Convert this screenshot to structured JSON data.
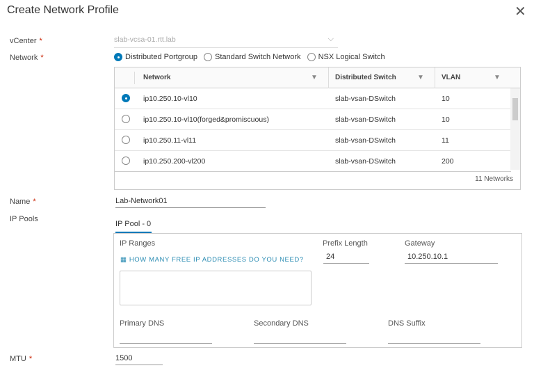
{
  "dialog": {
    "title": "Create Network Profile"
  },
  "vcenter": {
    "label": "vCenter",
    "required": "*",
    "value": "slab-vcsa-01.rtt.lab"
  },
  "network": {
    "label": "Network",
    "required": "*",
    "options": [
      "Distributed Portgroup",
      "Standard Switch Network",
      "NSX Logical Switch"
    ],
    "selected": 0,
    "columns": [
      "Network",
      "Distributed Switch",
      "VLAN"
    ],
    "rows": [
      {
        "network": "ip10.250.10-vl10",
        "switch": "slab-vsan-DSwitch",
        "vlan": "10",
        "selected": true
      },
      {
        "network": "ip10.250.10-vl10(forged&promiscuous)",
        "switch": "slab-vsan-DSwitch",
        "vlan": "10",
        "selected": false
      },
      {
        "network": "ip10.250.11-vl11",
        "switch": "slab-vsan-DSwitch",
        "vlan": "11",
        "selected": false
      },
      {
        "network": "ip10.250.200-vl200",
        "switch": "slab-vsan-DSwitch",
        "vlan": "200",
        "selected": false
      }
    ],
    "count": "11 Networks"
  },
  "name": {
    "label": "Name",
    "required": "*",
    "value": "Lab-Network01"
  },
  "ip_pools": {
    "label": "IP Pools",
    "tab": "IP Pool - 0",
    "ip_ranges": "IP Ranges",
    "link": "HOW MANY FREE IP ADDRESSES DO YOU NEED?",
    "prefix_label": "Prefix Length",
    "prefix": "24",
    "gateway_label": "Gateway",
    "gateway": "10.250.10.1",
    "primary_dns": "Primary DNS",
    "secondary_dns": "Secondary DNS",
    "dns_suffix": "DNS Suffix"
  },
  "mtu": {
    "label": "MTU",
    "required": "*",
    "value": "1500"
  },
  "colors": {
    "accent": "#0079b8",
    "link": "#2b8cb3",
    "required": "#c92100"
  }
}
